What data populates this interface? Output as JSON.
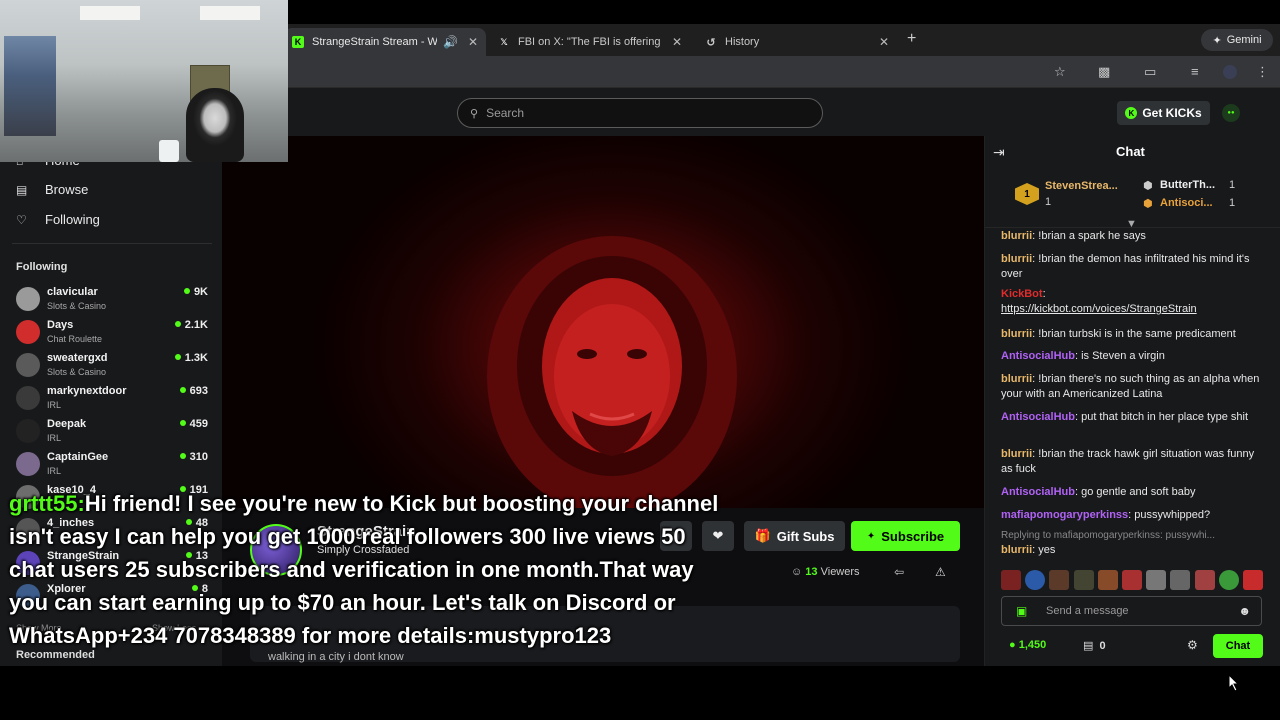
{
  "browser": {
    "tabs": [
      {
        "title": "StrangeStrain Stream - W",
        "favicon": "kick-icon",
        "active": true
      },
      {
        "title": "FBI on X: \"The FBI is offering",
        "favicon": "x-icon",
        "active": false
      },
      {
        "title": "History",
        "favicon": "history-icon",
        "active": false
      }
    ],
    "gemini_label": "Gemini"
  },
  "header": {
    "search_placeholder": "Search",
    "get_kicks_label": "Get KICKs"
  },
  "sidebar": {
    "nav": [
      {
        "label": "Home",
        "icon": "home-icon"
      },
      {
        "label": "Browse",
        "icon": "browse-icon"
      },
      {
        "label": "Following",
        "icon": "heart-icon"
      }
    ],
    "following_header": "Following",
    "channels": [
      {
        "name": "clavicular",
        "category": "Slots & Casino",
        "viewers": "9K",
        "color": "#9a9a9a"
      },
      {
        "name": "Days",
        "category": "Chat Roulette",
        "viewers": "2.1K",
        "color": "#d12d2d"
      },
      {
        "name": "sweatergxd",
        "category": "Slots & Casino",
        "viewers": "1.3K",
        "color": "#5a5a5a"
      },
      {
        "name": "markynextdoor",
        "category": "IRL",
        "viewers": "693",
        "color": "#3a3a3a"
      },
      {
        "name": "Deepak",
        "category": "IRL",
        "viewers": "459",
        "color": "#222"
      },
      {
        "name": "CaptainGee",
        "category": "IRL",
        "viewers": "310",
        "color": "#7b6a8e"
      },
      {
        "name": "kase10_4",
        "category": "",
        "viewers": "191",
        "color": "#6d6d6d"
      },
      {
        "name": "4_inches",
        "category": "",
        "viewers": "48",
        "color": "#555"
      },
      {
        "name": "StrangeStrain",
        "category": "",
        "viewers": "13",
        "color": "#5c43b8"
      },
      {
        "name": "Xplorer",
        "category": "",
        "viewers": "8",
        "color": "#3c5c8c"
      }
    ],
    "show_more": "Show More",
    "show_less": "Show Less",
    "recommended_header": "Recommended"
  },
  "stream": {
    "channel_name": "StrangeStrain",
    "category": "Simply Crossfaded",
    "viewers_count": "13",
    "viewers_label": "Viewers",
    "gift_subs_label": "Gift Subs",
    "subscribe_label": "Subscribe",
    "title": "walking in a city i dont know"
  },
  "chat": {
    "title": "Chat",
    "gifters": [
      {
        "name": "StevenStrea...",
        "count": "1",
        "rank": "1"
      },
      {
        "name": "ButterTh...",
        "count": "1"
      },
      {
        "name": "Antisoci...",
        "count": "1"
      }
    ],
    "messages": [
      {
        "user": "blurrii",
        "color": "#e8b86a",
        "text": "!brian a spark he says"
      },
      {
        "user": "blurrii",
        "color": "#e8b86a",
        "text": "!brian the demon has infiltrated his mind it's over"
      },
      {
        "user": "KickBot",
        "color": "#e02c2c",
        "text": "https://kickbot.com/voices/StrangeStrain"
      },
      {
        "user": "blurrii",
        "color": "#e8b86a",
        "text": "!brian turbski is in the same predicament"
      },
      {
        "user": "AntisocialHub",
        "color": "#b062f5",
        "text": "is Steven a virgin"
      },
      {
        "user": "blurrii",
        "color": "#e8b86a",
        "text": "!brian there's no such thing as an alpha when your with an Americanized Latina"
      },
      {
        "user": "AntisocialHub",
        "color": "#b062f5",
        "text": "put that bitch in her place type shit"
      },
      {
        "user": "blurrii",
        "color": "#e8b86a",
        "text": "!brian the track hawk girl situation was funny as fuck"
      },
      {
        "user": "AntisocialHub",
        "color": "#b062f5",
        "text": "go gentle and soft baby"
      },
      {
        "user": "mafiapomogaryperkinss",
        "color": "#b062f5",
        "text": "pussywhipped?"
      },
      {
        "user": "blurrii",
        "color": "#e8b86a",
        "text": "yes",
        "reply_to": "Replying to mafiapomogaryperkinss: pussywhi..."
      }
    ],
    "send_placeholder": "Send a message",
    "points": "1,450",
    "inventory": "0",
    "send_label": "Chat"
  },
  "overlay": {
    "user": "grttt55:",
    "message": "Hi friend! I see you're new to Kick but boosting your channel isn't easy I can help you get 1000 real followers 300 live views 50 chat users 25 subscribers and verification in one month.That way you can start earning up to $70 an hour. Let's talk on Discord or WhatsApp+234 7078348389 for more details:mustypro123"
  },
  "colors": {
    "accent": "#53fc18",
    "panel": "#18191b"
  }
}
